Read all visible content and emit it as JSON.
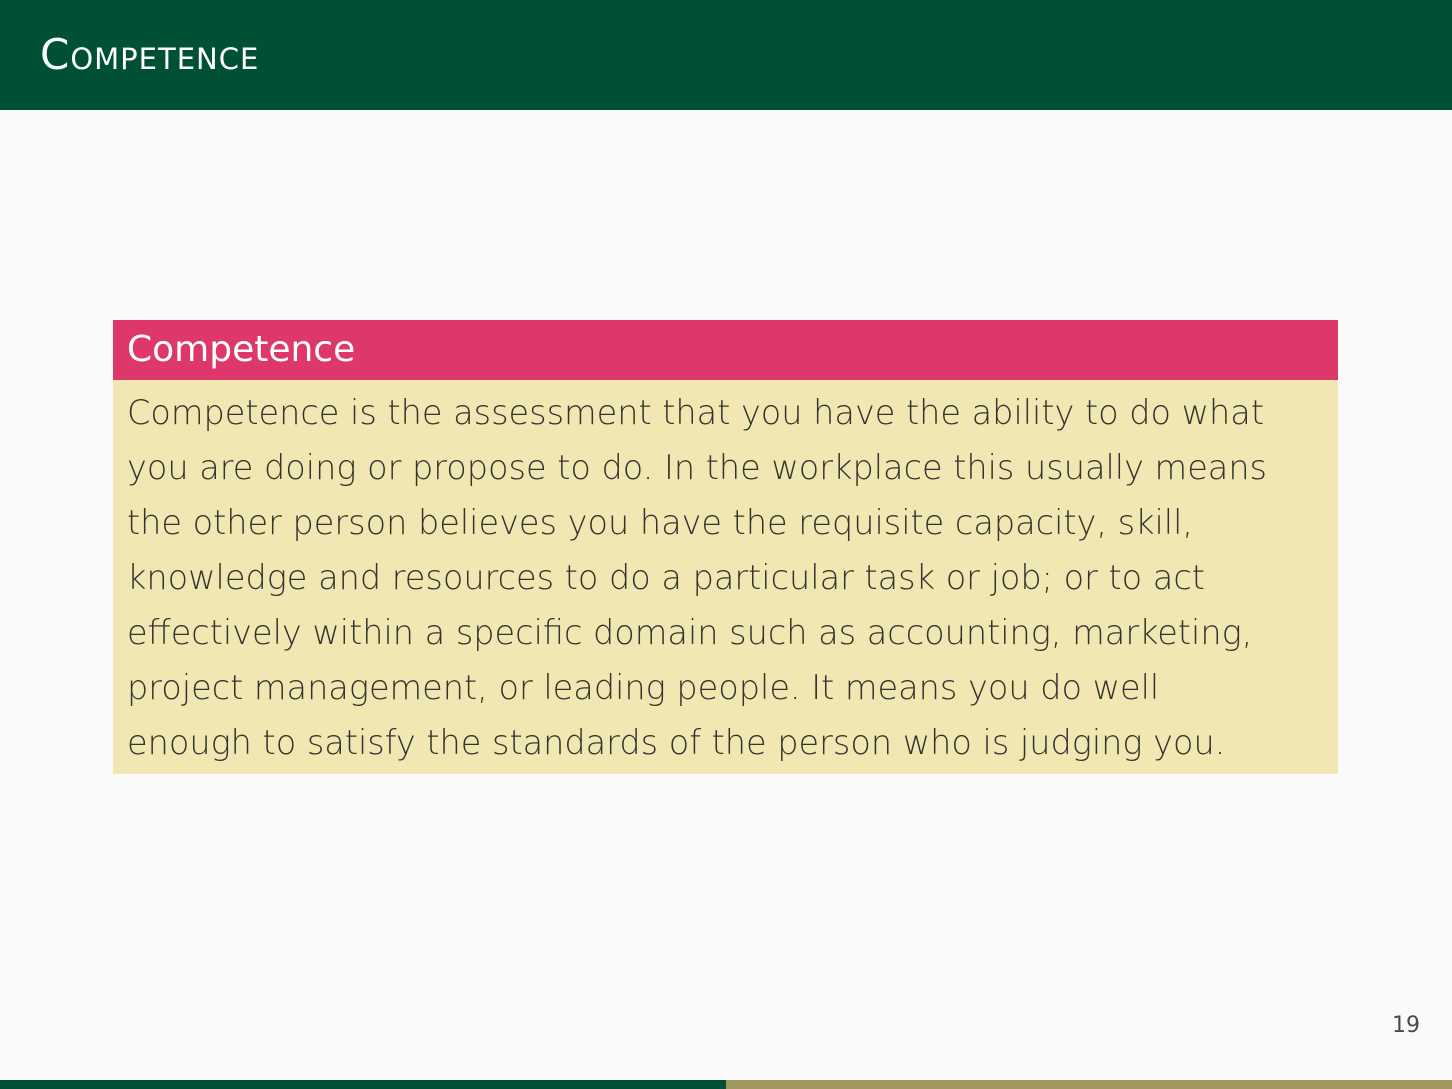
{
  "header": {
    "title": "Competence"
  },
  "block": {
    "title": "Competence",
    "lines": [
      "Competence is the assessment that you have the ability to do what",
      "you are doing or propose to do. In the workplace this usually means",
      "the other person believes you have the requisite capacity, skill,",
      "knowledge and resources to do a particular task or job; or to act",
      "effectively within a specific domain such as accounting, marketing,",
      "project management, or leading people. It means you do well",
      "enough to satisfy the standards of the person who is judging you."
    ]
  },
  "footer": {
    "page_number": "19",
    "progress": 0.5
  },
  "colors": {
    "header_bg": "#005035",
    "block_title_bg": "#de376c",
    "block_body_bg": "#f0e7b3",
    "progress_fill": "#005035",
    "progress_track": "#a0975f"
  }
}
